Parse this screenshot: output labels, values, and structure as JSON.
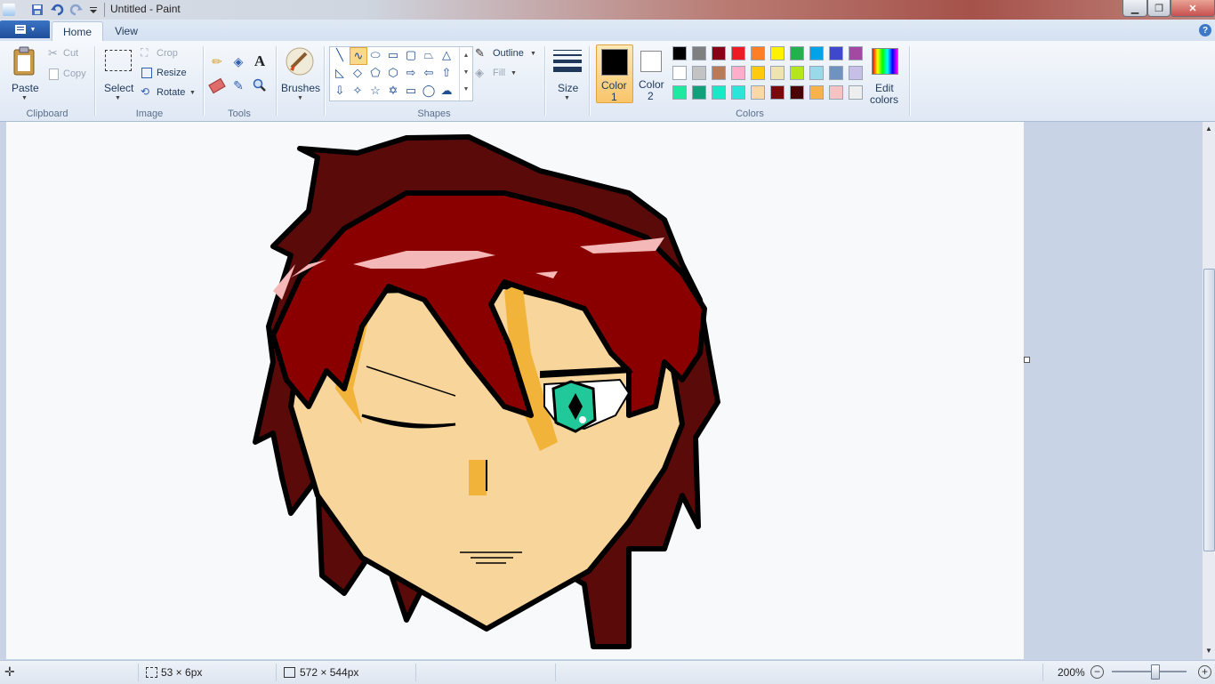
{
  "window": {
    "title": "Untitled - Paint",
    "controls": [
      "minimize",
      "maximize",
      "close"
    ]
  },
  "quick_access": [
    "save-icon",
    "undo-icon",
    "redo-icon",
    "customize-icon"
  ],
  "ribbon": {
    "app_menu_icon": "paint-menu-icon",
    "tabs": [
      "Home",
      "View"
    ],
    "active_tab": "Home",
    "clipboard": {
      "label": "Clipboard",
      "paste": "Paste",
      "cut": "Cut",
      "copy": "Copy"
    },
    "image": {
      "label": "Image",
      "select": "Select",
      "crop": "Crop",
      "resize": "Resize",
      "rotate": "Rotate"
    },
    "tools": {
      "label": "Tools",
      "items": [
        "pencil-icon",
        "fill-icon",
        "text-icon",
        "eraser-icon",
        "color-picker-icon",
        "magnifier-icon"
      ]
    },
    "brushes": {
      "label": "Brushes"
    },
    "shapes": {
      "label": "Shapes",
      "outline": "Outline",
      "fill": "Fill"
    },
    "size": {
      "label": "Size"
    },
    "colors": {
      "label": "Colors",
      "color1_label": "Color",
      "color1_num": "1",
      "color2_label": "Color",
      "color2_num": "2",
      "color1": "#000000",
      "color2": "#ffffff",
      "edit_colors_1": "Edit",
      "edit_colors_2": "colors",
      "palette": [
        [
          "#000000",
          "#7f7f7f",
          "#880015",
          "#ed1c24",
          "#ff7f27",
          "#fff200",
          "#22b14c",
          "#00a2e8",
          "#3f48cc",
          "#a349a4"
        ],
        [
          "#ffffff",
          "#c3c3c3",
          "#b97a57",
          "#ffaec9",
          "#ffc90e",
          "#efe4b0",
          "#b5e61d",
          "#99d9ea",
          "#7092be",
          "#c8bfe7"
        ],
        [
          "#1de9a0",
          "#11a07a",
          "#19e8c8",
          "#2be6d8",
          "#fbd8a8",
          "#7a0a0a",
          "#4a0000",
          "#f7b24a",
          "#f6c2c2",
          "#eeeeee"
        ]
      ]
    }
  },
  "status": {
    "selection_size": "53 × 6px",
    "image_size": "572 × 544px",
    "zoom": "200%"
  }
}
